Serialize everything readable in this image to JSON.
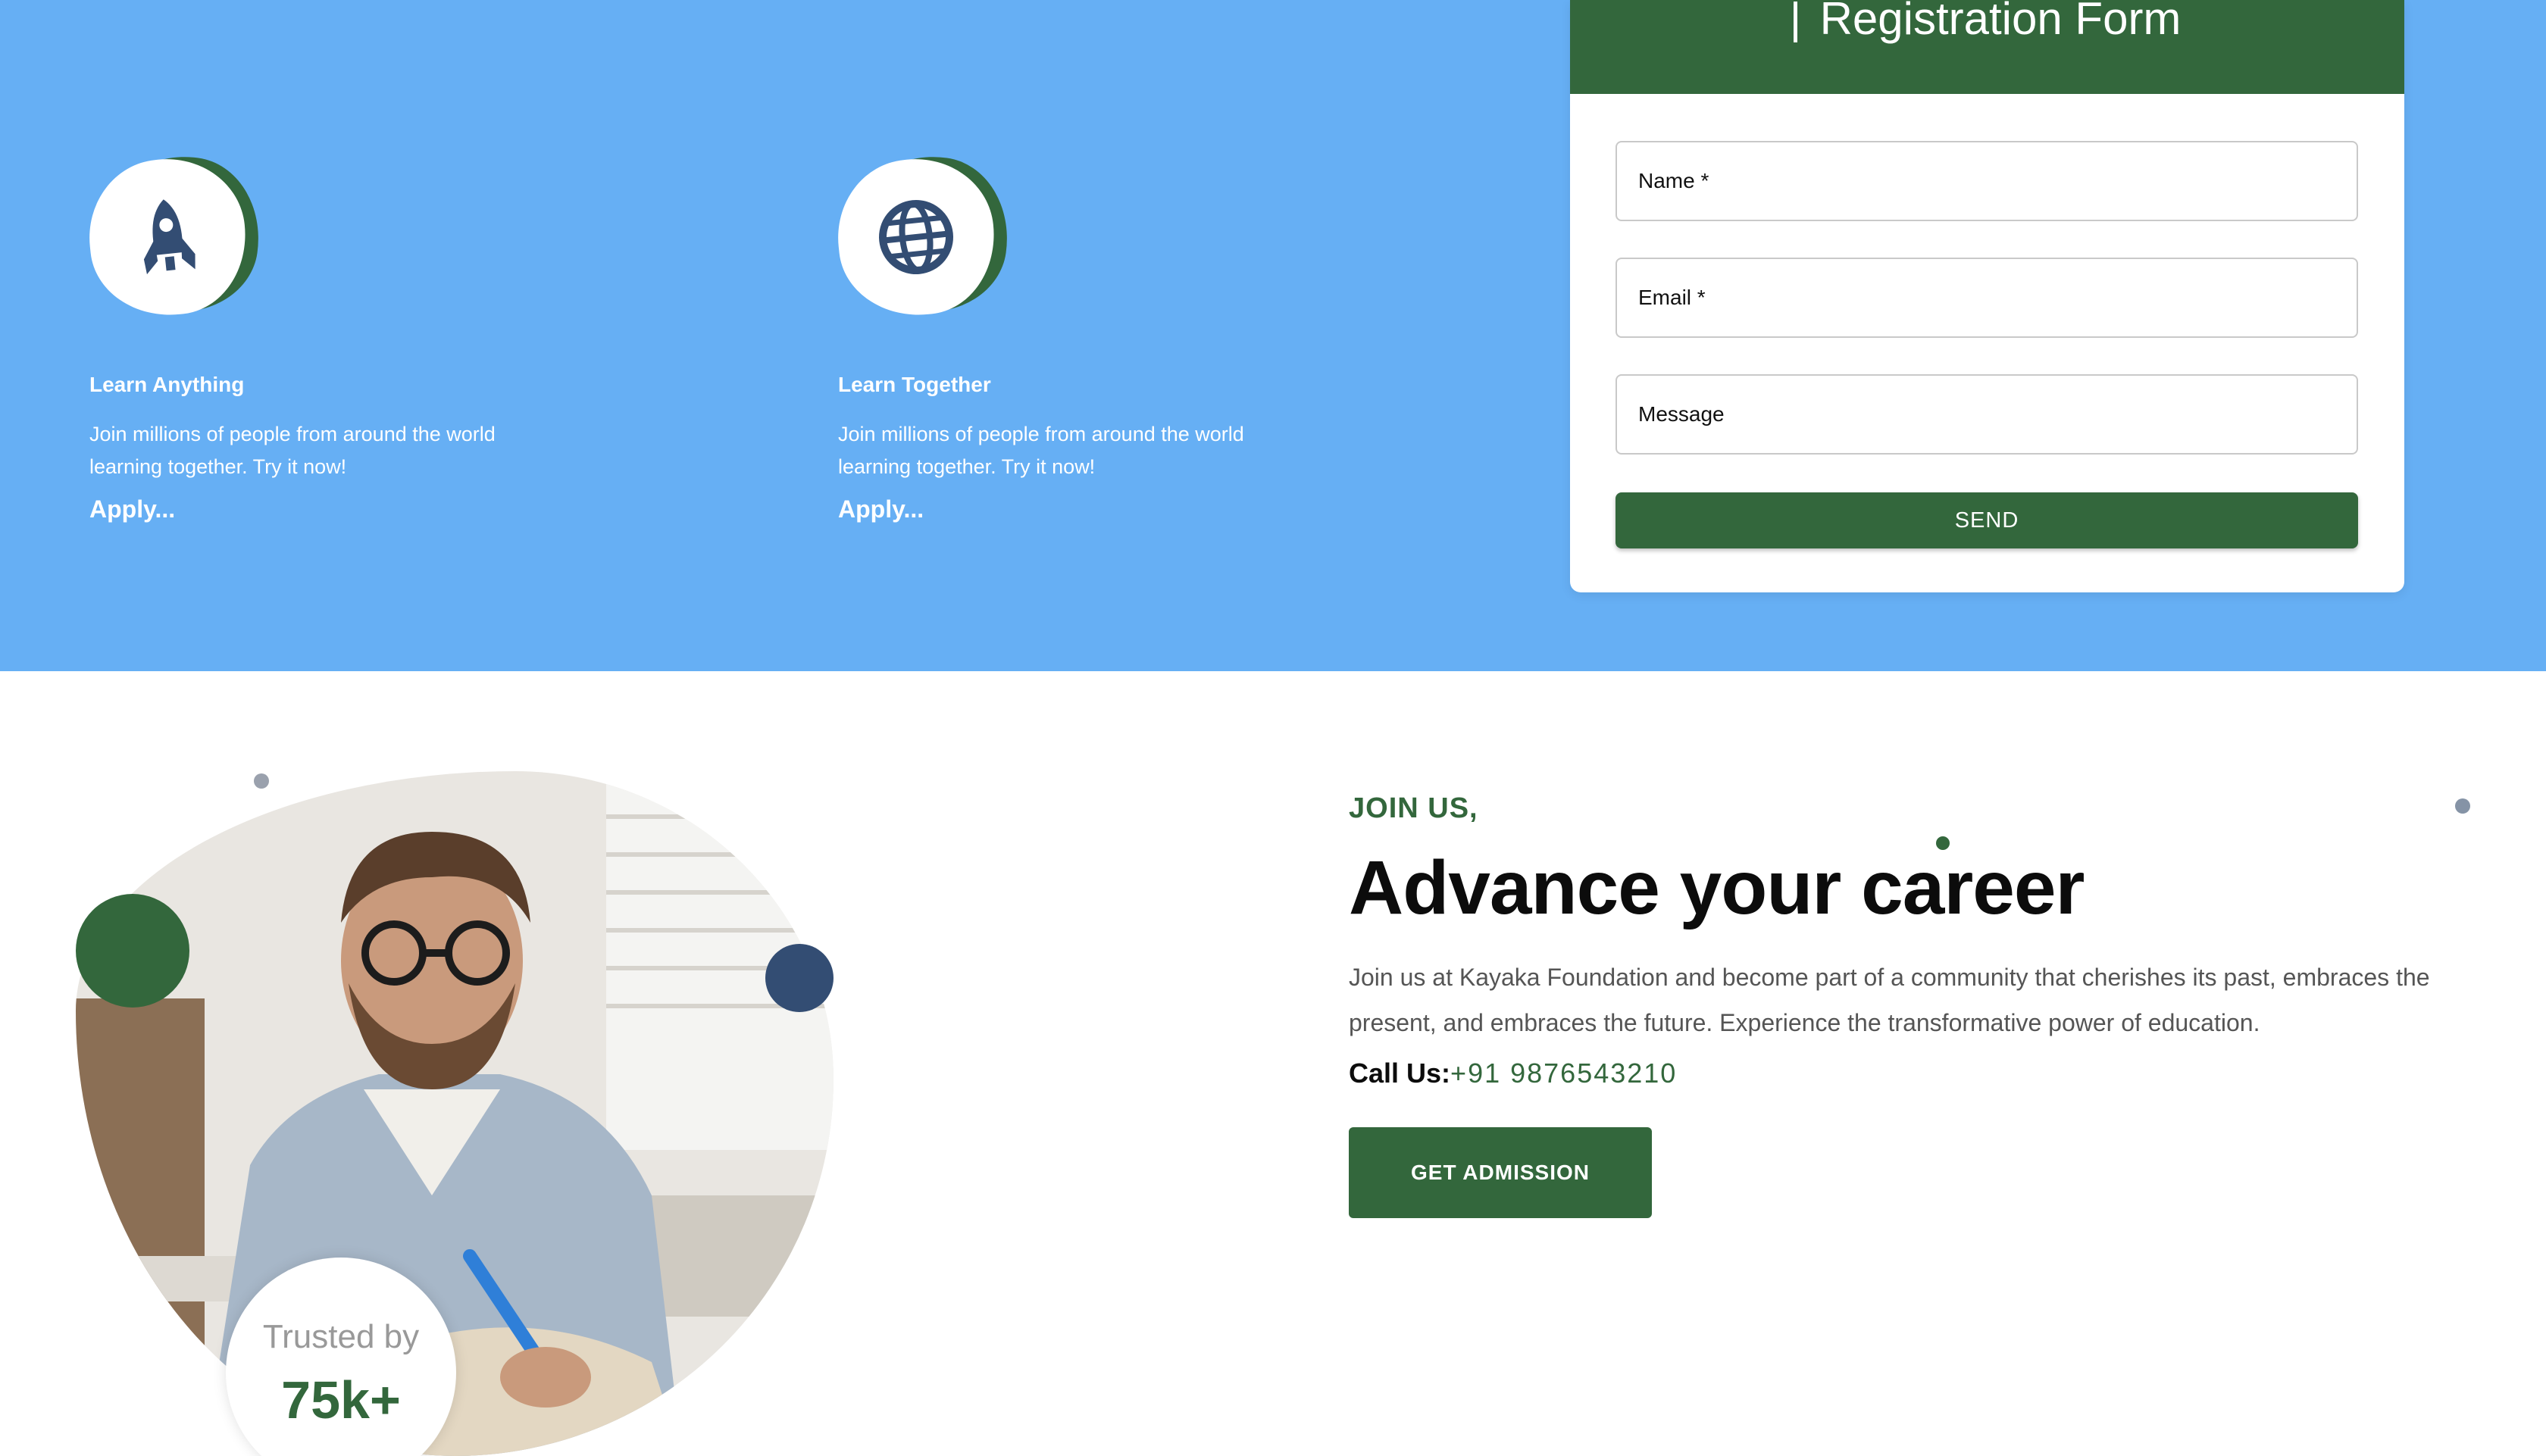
{
  "features": [
    {
      "icon": "rocket-icon",
      "title": "Learn Anything",
      "description": "Join millions of people from around the world learning together. Try it now!",
      "link": "Apply..."
    },
    {
      "icon": "globe-icon",
      "title": "Learn Together",
      "description": "Join millions of people from around the world learning together. Try it now!",
      "link": "Apply..."
    }
  ],
  "registration": {
    "title": "Registration Form",
    "name_placeholder": "Name *",
    "email_placeholder": "Email *",
    "message_placeholder": "Message",
    "send_label": "SEND"
  },
  "join": {
    "eyebrow": "JOIN US,",
    "heading": "Advance your career",
    "description": "Join us at Kayaka Foundation and become part of a community that cherishes its past, embraces the present, and embraces the future. Experience the transformative power of education.",
    "call_label": "Call Us:",
    "call_number": "+91 9876543210",
    "button_label": "GET ADMISSION"
  },
  "trusted": {
    "label": "Trusted by",
    "count": "75k+"
  },
  "colors": {
    "band": "#66aff4",
    "brand_green": "#33673c",
    "navy": "#334d73"
  }
}
